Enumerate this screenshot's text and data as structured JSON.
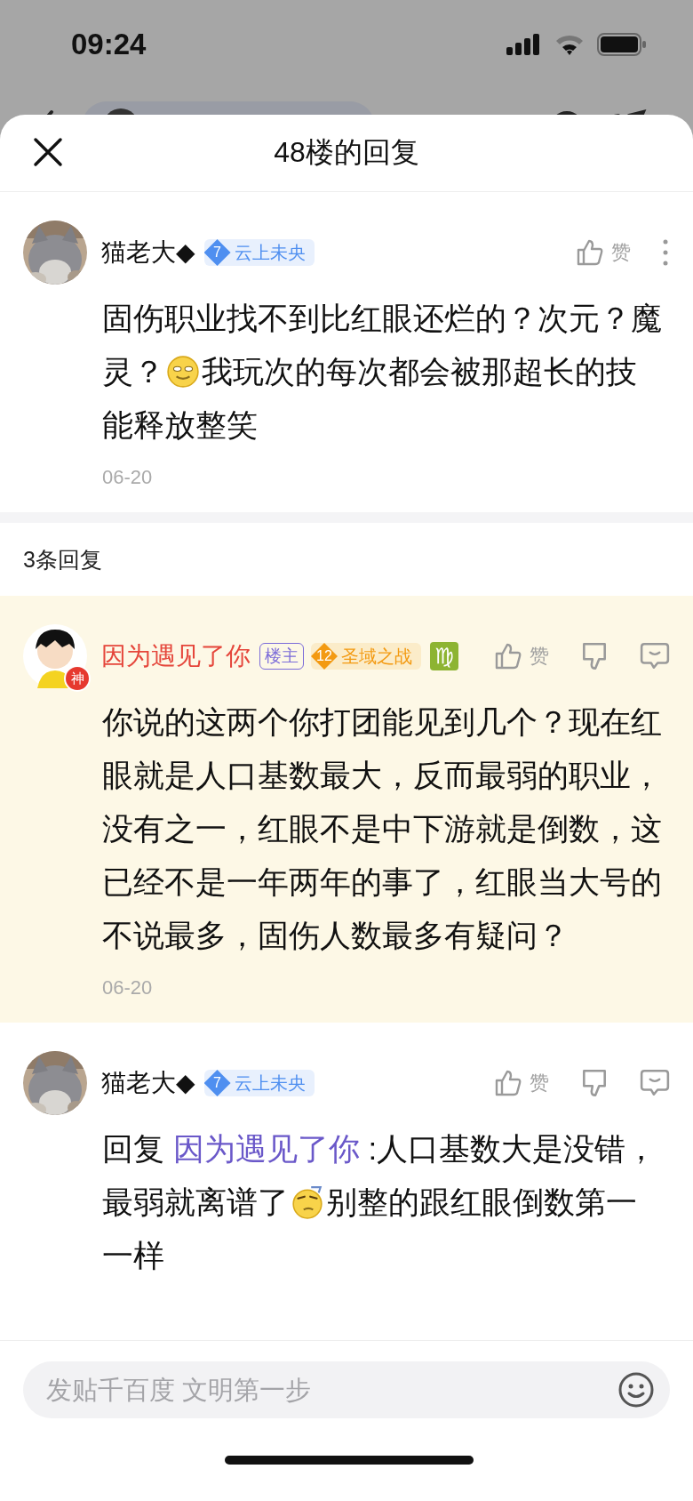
{
  "status_bar": {
    "time": "09:24"
  },
  "sheet": {
    "title": "48楼的回复"
  },
  "main_comment": {
    "author": "猫老大◆",
    "color": "#111111",
    "level": {
      "text": "7",
      "color": "#4f8ff0"
    },
    "title": "云上未央",
    "highlighted": false,
    "actions": [
      {
        "kind": "like",
        "label": "赞"
      },
      {
        "kind": "more"
      }
    ],
    "body": [
      {
        "kind": "text",
        "text": "固伤职业找不到比红眼还烂的？次元？魔灵？"
      },
      {
        "kind": "emoji-smile"
      },
      {
        "kind": "text",
        "text": "我玩次的每次都会被那超长的技能释放整笑"
      }
    ],
    "date": "06-20"
  },
  "reply_count": "3条回复",
  "replies": [
    {
      "avatar": {
        "kind": "figure",
        "badge": "神"
      },
      "author": "因为遇见了你",
      "color": "#e5463b",
      "op_tag": "楼主",
      "level": {
        "text": "12",
        "color": "#f39a12"
      },
      "title": "圣域之战",
      "zodiac": "♍",
      "highlighted": true,
      "actions": [
        {
          "kind": "like",
          "label": "赞"
        },
        {
          "kind": "dislike"
        },
        {
          "kind": "comment"
        }
      ],
      "body": [
        {
          "kind": "text",
          "text": "你说的这两个你打团能见到几个？现在红眼就是人口基数最大，反而最弱的职业，没有之一，红眼不是中下游就是倒数，这已经不是一年两年的事了，红眼当大号的不说最多，固伤人数最多有疑问？"
        }
      ],
      "date": "06-20"
    },
    {
      "author": "猫老大◆",
      "color": "#111111",
      "level": {
        "text": "7",
        "color": "#4f8ff0"
      },
      "title": "云上未央",
      "highlighted": false,
      "actions": [
        {
          "kind": "like",
          "label": "赞"
        },
        {
          "kind": "dislike"
        },
        {
          "kind": "comment"
        }
      ],
      "body": [
        {
          "kind": "text",
          "text": "回复 "
        },
        {
          "kind": "link",
          "text": "因为遇见了你"
        },
        {
          "kind": "text",
          "text": " :人口基数大是没错，最弱就离谱了"
        },
        {
          "kind": "emoji-think"
        },
        {
          "kind": "text",
          "text": "别整的跟红眼倒数第一一样"
        }
      ]
    }
  ],
  "composer": {
    "placeholder": "发贴千百度 文明第一步"
  }
}
